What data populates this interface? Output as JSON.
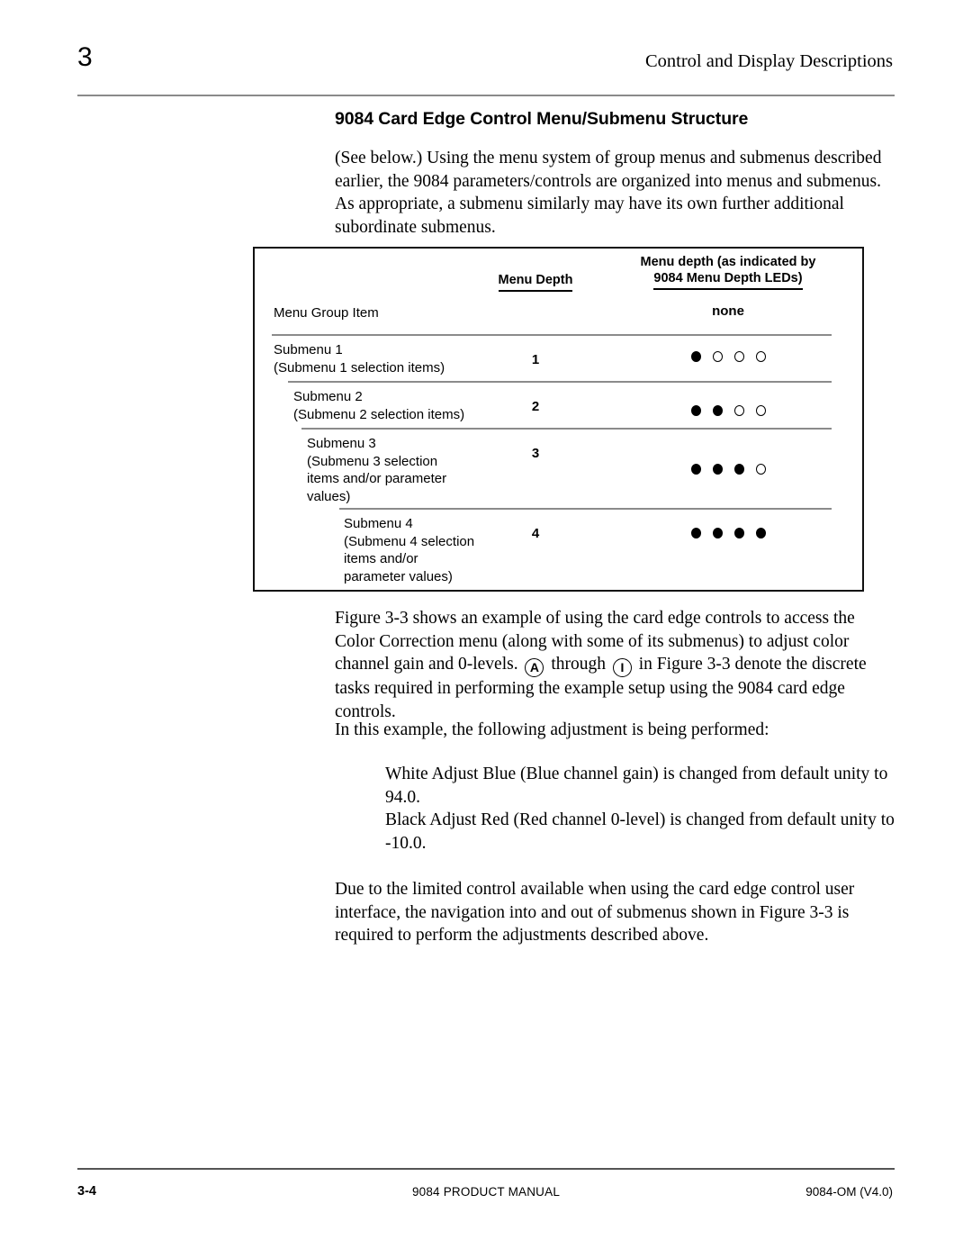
{
  "header": {
    "chapter_number": "3",
    "running_head": "Control and Display Descriptions"
  },
  "section": {
    "title": "9084 Card Edge Control Menu/Submenu Structure"
  },
  "paragraphs": {
    "intro": "(See below.) Using the menu system of group menus and submenus described earlier, the 9084 parameters/controls are organized into menus and submenus. As appropriate, a submenu similarly may have its own further additional subordinate submenus.",
    "figure_ref_pre": "Figure 3-3 shows an example of using the card edge controls to access the Color Correction menu (along with some of its submenus) to adjust color channel gain and 0-levels.",
    "badge_a": "A",
    "figure_ref_mid": "through",
    "badge_i": "I",
    "figure_ref_post": "in Figure 3-3 denote the discrete tasks required in performing the example setup using the 9084 card edge controls.",
    "example_lead": "In this example, the following adjustment is being performed:",
    "bullet_white": "White Adjust Blue (Blue channel gain) is changed from default unity to 94.0.",
    "bullet_black": "Black Adjust Red (Red channel 0-level) is changed from default unity to -10.0.",
    "closing": "Due to the limited control available when using the card edge control user interface, the navigation into and out of submenus shown in Figure 3-3 is required to perform the adjustments described above."
  },
  "figure": {
    "headers": {
      "menu_depth": "Menu Depth",
      "leds_line1": "Menu depth (as indicated by",
      "leds_line2": "9084 Menu Depth LEDs)"
    },
    "group_row": {
      "label": "Menu Group Item",
      "leds_text": "none"
    },
    "rows": [
      {
        "label": "Submenu 1\n (Submenu 1 selection items)",
        "depth": "1",
        "leds": [
          true,
          false,
          false,
          false
        ]
      },
      {
        "label": "Submenu 2\n (Submenu 2 selection items)",
        "depth": "2",
        "leds": [
          true,
          true,
          false,
          false
        ]
      },
      {
        "label": "Submenu 3\n (Submenu 3 selection\n items and/or parameter\n values)",
        "depth": "3",
        "leds": [
          true,
          true,
          true,
          false
        ]
      },
      {
        "label": "Submenu 4\n (Submenu 4 selection\n items and/or\n parameter values)",
        "depth": "4",
        "leds": [
          true,
          true,
          true,
          true
        ]
      }
    ]
  },
  "footer": {
    "page_number": "3-4",
    "manual_title": "9084 PRODUCT MANUAL",
    "doc_id": "9084-OM  (V4.0)"
  }
}
